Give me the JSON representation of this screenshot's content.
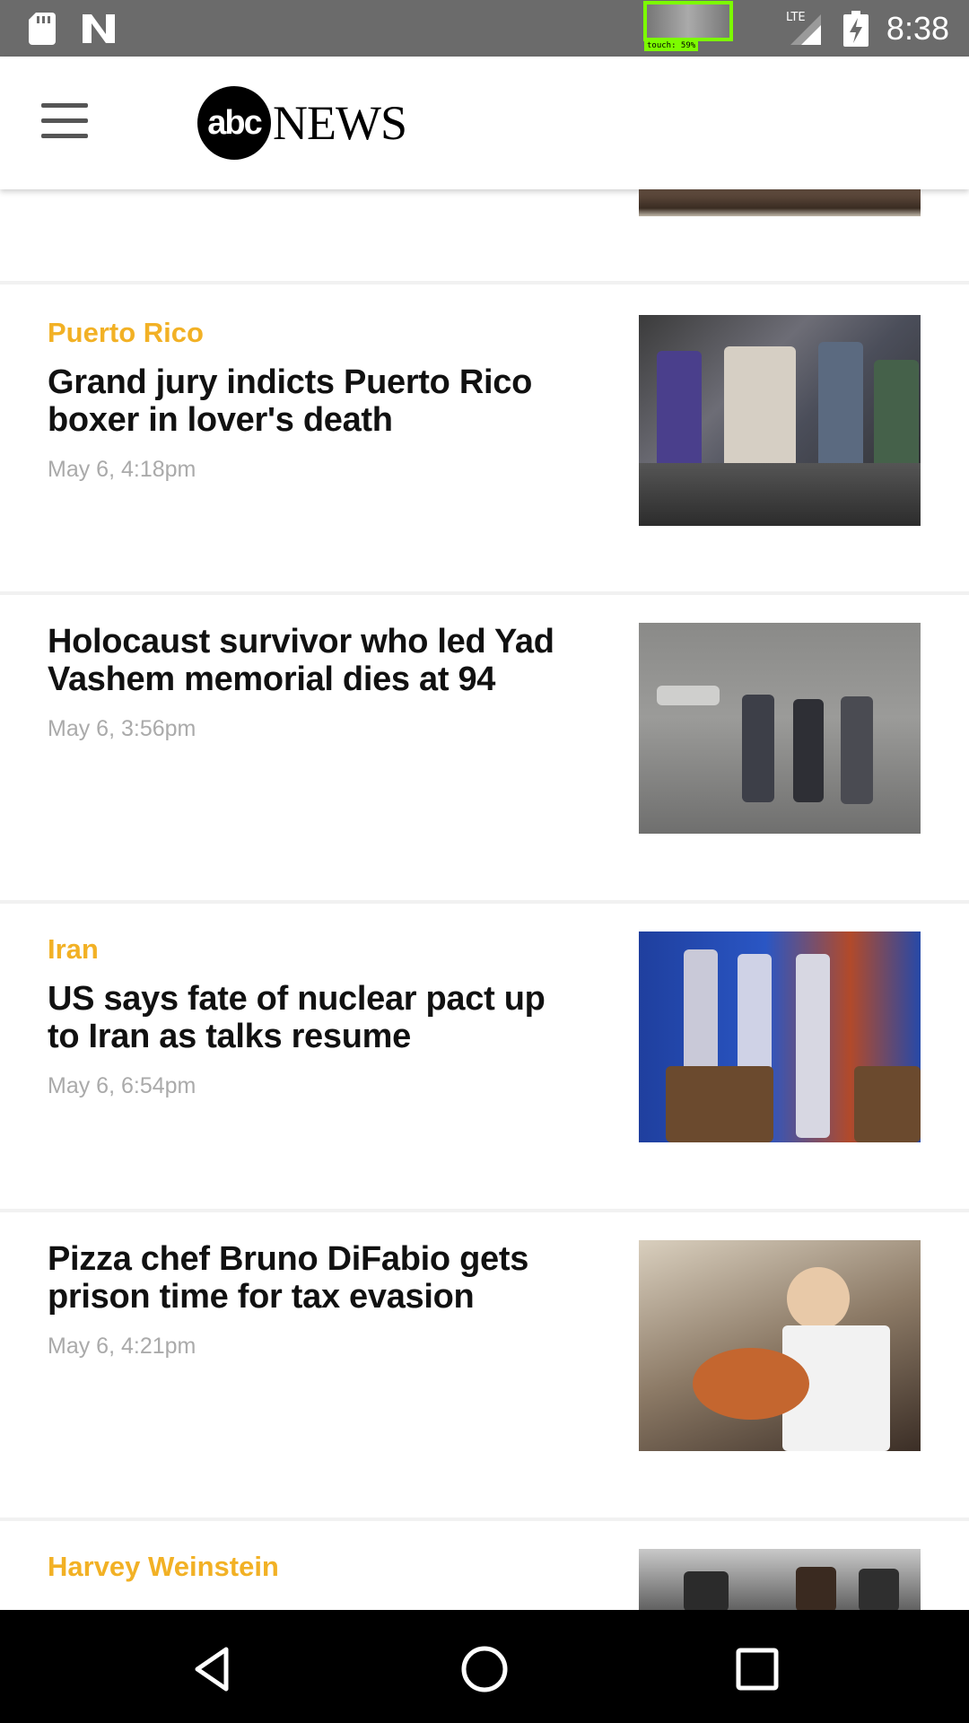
{
  "status_bar": {
    "time": "8:38",
    "network": "LTE",
    "touch_label": "touch: 59%",
    "icons": [
      "sd-card-icon",
      "n-notification-icon",
      "lte-signal-icon",
      "battery-icon"
    ]
  },
  "header": {
    "logo_mark": "abc",
    "logo_word": "NEWS",
    "menu_icon": "hamburger-menu-icon"
  },
  "articles": [
    {
      "kicker": "Puerto Rico",
      "headline": "Grand jury indicts Puerto Rico boxer in lover's death",
      "timestamp": "May 6, 4:18pm"
    },
    {
      "kicker": "",
      "headline": "Holocaust survivor who led Yad Vashem memorial dies at 94",
      "timestamp": "May 6, 3:56pm"
    },
    {
      "kicker": "Iran",
      "headline": "US says fate of nuclear pact up to Iran as talks resume",
      "timestamp": "May 6, 6:54pm"
    },
    {
      "kicker": "",
      "headline": "Pizza chef Bruno DiFabio gets prison time for tax evasion",
      "timestamp": "May 6, 4:21pm"
    },
    {
      "kicker": "Harvey Weinstein",
      "headline": "",
      "timestamp": ""
    }
  ],
  "colors": {
    "kicker": "#f2b125",
    "status_bar": "#6b6b6b",
    "nav_bar": "#000000"
  },
  "nav_bar": {
    "icons": [
      "back-icon",
      "home-icon",
      "recents-icon"
    ]
  }
}
